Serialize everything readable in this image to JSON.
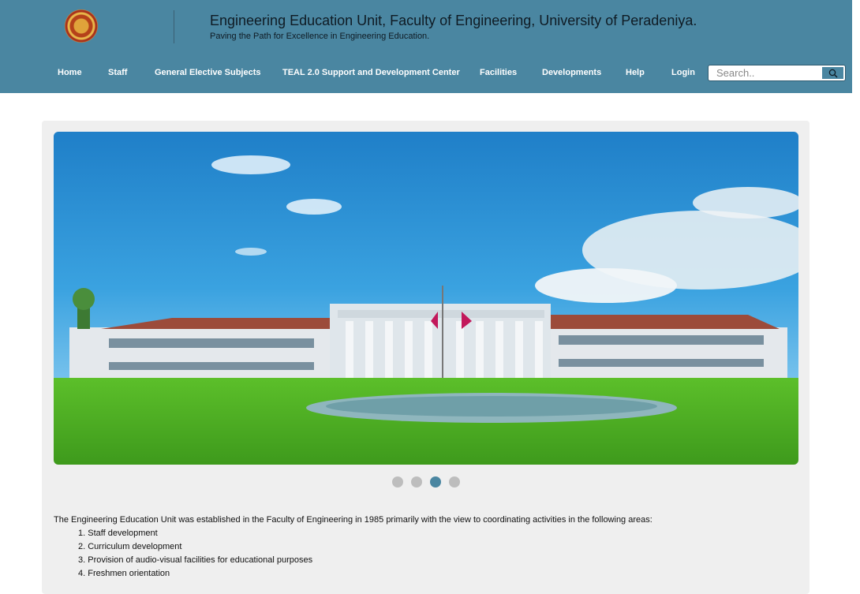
{
  "header": {
    "title": "Engineering Education Unit, Faculty of Engineering, University of Peradeniya.",
    "tagline": "Paving the Path for Excellence in Engineering Education."
  },
  "nav": {
    "items": [
      {
        "label": "Home"
      },
      {
        "label": "Staff"
      },
      {
        "label": "General Elective Subjects"
      },
      {
        "label": "TEAL 2.0 Support and Development Center"
      },
      {
        "label": "Facilities"
      },
      {
        "label": "Developments"
      },
      {
        "label": "Help"
      },
      {
        "label": "Login"
      }
    ]
  },
  "search": {
    "placeholder": "Search..",
    "icon": "search-icon"
  },
  "carousel": {
    "slide_count": 4,
    "active_index": 2,
    "dot_color": "#bdbdbd",
    "active_dot_color": "#4a86a1"
  },
  "content": {
    "intro": "The Engineering Education Unit was established in the Faculty of Engineering in 1985 primarily with the view to coordinating activities in the following areas:",
    "list": [
      "1. Staff development",
      "2. Curriculum development",
      "3. Provision of audio-visual facilities for educational purposes",
      "4. Freshmen orientation"
    ]
  },
  "colors": {
    "header_bg": "#4a86a1",
    "panel_bg": "#efefef"
  }
}
